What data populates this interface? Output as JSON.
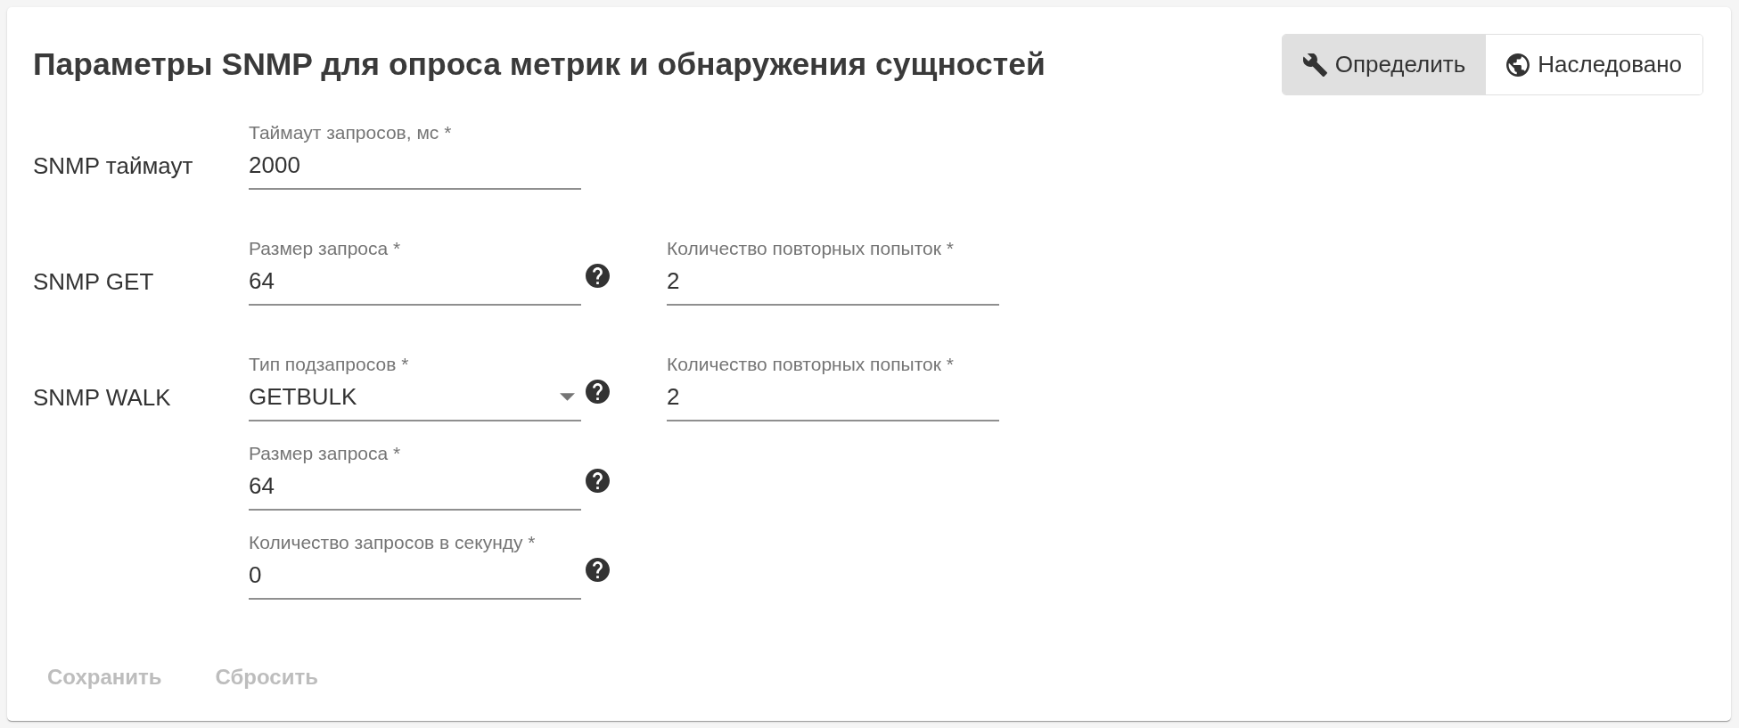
{
  "title": "Параметры SNMP для опроса метрик и обнаружения сущностей",
  "mode_toggle": [
    {
      "kind": "define",
      "label": "Определить",
      "selected": true
    },
    {
      "kind": "inherit",
      "label": "Наследовано",
      "selected": false
    }
  ],
  "sections": [
    {
      "label": "SNMP таймаут",
      "rows": [
        [
          {
            "kind": "text",
            "label": "Таймаут запросов, мс *",
            "value": "2000",
            "help": false
          }
        ]
      ]
    },
    {
      "label": "SNMP GET",
      "rows": [
        [
          {
            "kind": "text",
            "label": "Размер запроса *",
            "value": "64",
            "help": true
          },
          {
            "kind": "text",
            "label": "Количество повторных попыток *",
            "value": "2",
            "help": false
          }
        ]
      ]
    },
    {
      "label": "SNMP WALK",
      "rows": [
        [
          {
            "kind": "select",
            "label": "Тип подзапросов *",
            "value": "GETBULK",
            "help": true
          },
          {
            "kind": "text",
            "label": "Количество повторных попыток *",
            "value": "2",
            "help": false
          }
        ],
        [
          {
            "kind": "text",
            "label": "Размер запроса *",
            "value": "64",
            "help": true
          }
        ],
        [
          {
            "kind": "text",
            "label": "Количество запросов в секунду *",
            "value": "0",
            "help": true
          }
        ]
      ]
    }
  ],
  "actions": [
    {
      "label": "Сохранить",
      "disabled": true
    },
    {
      "label": "Сбросить",
      "disabled": true
    }
  ]
}
